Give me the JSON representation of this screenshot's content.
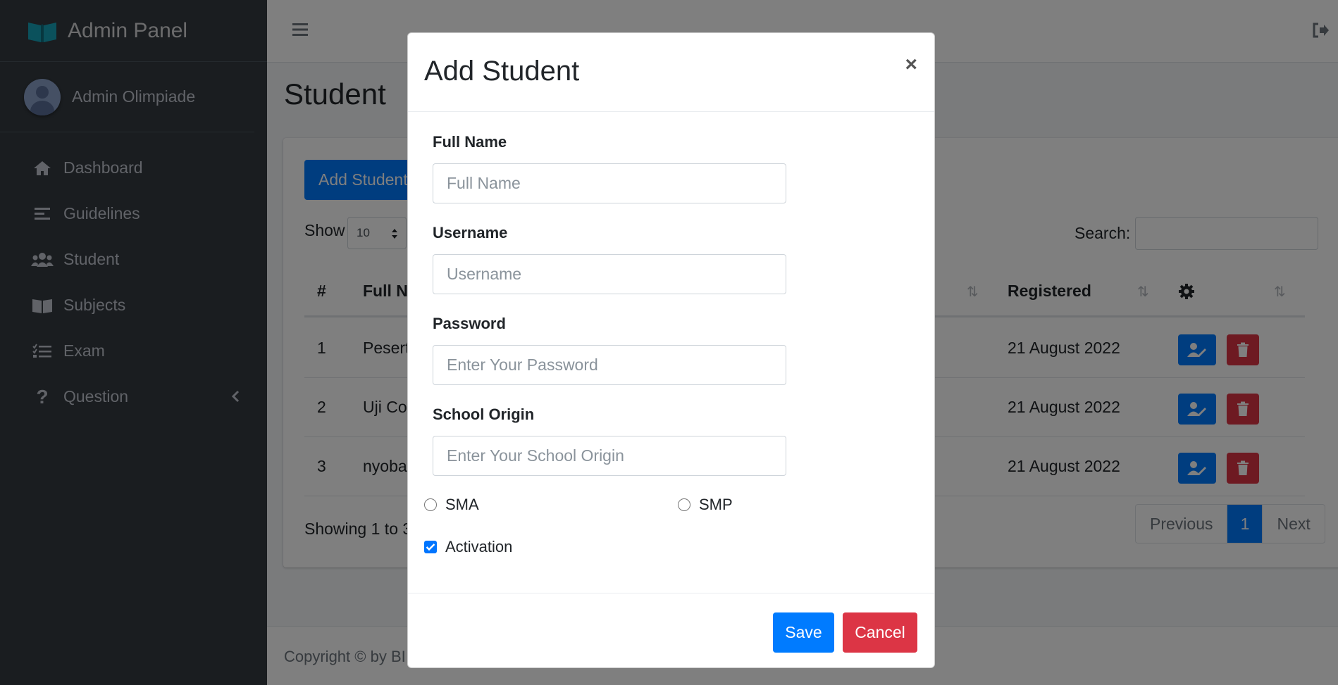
{
  "brand": {
    "title": "Admin Panel",
    "icon": "book-open-icon"
  },
  "user": {
    "name": "Admin Olimpiade"
  },
  "sidebar": {
    "items": [
      {
        "label": "Dashboard",
        "icon": "home-icon"
      },
      {
        "label": "Guidelines",
        "icon": "align-left-icon"
      },
      {
        "label": "Student",
        "icon": "users-icon"
      },
      {
        "label": "Subjects",
        "icon": "book-icon"
      },
      {
        "label": "Exam",
        "icon": "tasks-icon"
      },
      {
        "label": "Question",
        "icon": "question-icon"
      }
    ]
  },
  "page": {
    "title": "Student"
  },
  "toolbar": {
    "add_label": "Add Student"
  },
  "table_controls": {
    "show_label": "Show",
    "show_value": "10",
    "search_label": "Search:"
  },
  "table": {
    "headers": [
      "#",
      "Full Na",
      "Registered"
    ],
    "rows": [
      {
        "num": "1",
        "name": "Pesert",
        "registered": "21 August 2022"
      },
      {
        "num": "2",
        "name": "Uji Col",
        "registered": "21 August 2022"
      },
      {
        "num": "3",
        "name": "nyoba",
        "registered": "21 August 2022"
      }
    ]
  },
  "info": {
    "showing": "Showing 1 to 3"
  },
  "pagination": {
    "previous": "Previous",
    "current": "1",
    "next": "Next"
  },
  "footer": {
    "text": "Copyright © by BI"
  },
  "modal": {
    "title": "Add Student",
    "close": "×",
    "fields": {
      "full_name": {
        "label": "Full Name",
        "placeholder": "Full Name",
        "value": ""
      },
      "username": {
        "label": "Username",
        "placeholder": "Username",
        "value": ""
      },
      "password": {
        "label": "Password",
        "placeholder": "Enter Your Password",
        "value": ""
      },
      "school": {
        "label": "School Origin",
        "placeholder": "Enter Your School Origin",
        "value": ""
      }
    },
    "radios": [
      {
        "label": "SMA",
        "checked": false
      },
      {
        "label": "SMP",
        "checked": false
      }
    ],
    "activation": {
      "label": "Activation",
      "checked": true
    },
    "save_label": "Save",
    "cancel_label": "Cancel"
  },
  "colors": {
    "primary": "#007bff",
    "danger": "#dc3545",
    "sidebar": "#343a40",
    "brand_icon": "#20c997"
  }
}
